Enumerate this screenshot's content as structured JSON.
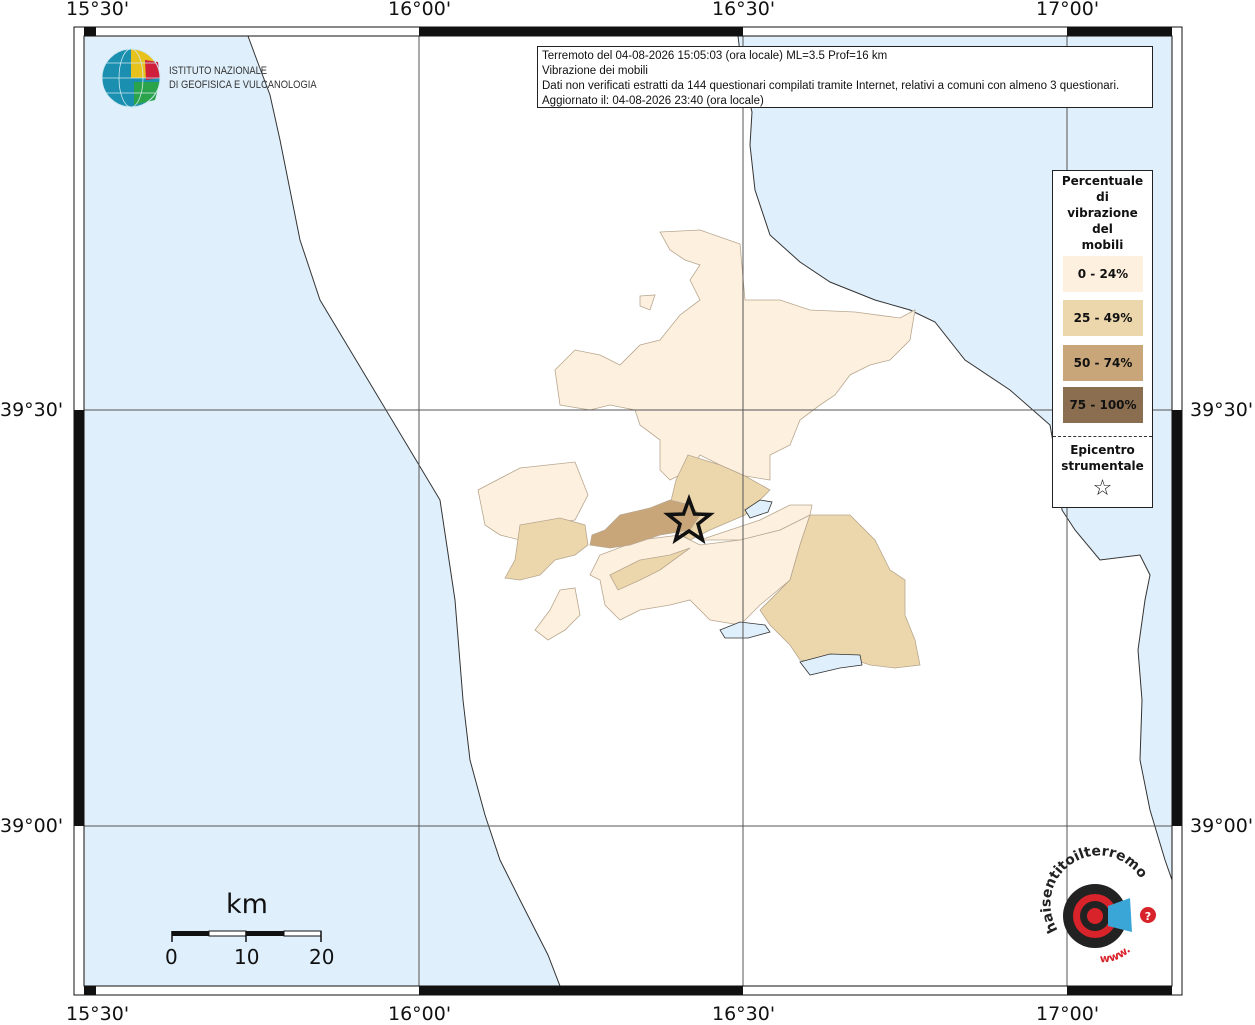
{
  "info": {
    "line1": "Terremoto del 04-08-2026 15:05:03 (ora locale) ML=3.5 Prof=16 km",
    "line2": "Vibrazione dei mobili",
    "line3": "Dati non verificati estratti da 144 questionari compilati tramite Internet, relativi a comuni con almeno 3 questionari.",
    "line4": "Aggiornato il: 04-08-2026 23:40 (ora locale)"
  },
  "frame": {
    "top_labels": [
      "15°30'",
      "16°00'",
      "16°30'",
      "17°00'"
    ],
    "bottom_labels": [
      "15°30'",
      "16°00'",
      "16°30'",
      "17°00'"
    ],
    "left_labels": [
      "39°30'",
      "39°00'"
    ],
    "right_labels": [
      "39°30'",
      "39°00'"
    ]
  },
  "logo": {
    "line1": "ISTITUTO NAZIONALE",
    "line2": "DI GEOFISICA E VULCANOLOGIA"
  },
  "legend": {
    "title_lines": [
      "Percentuale",
      "di",
      "vibrazione",
      "del",
      "mobili"
    ],
    "classes": [
      {
        "label": "0 - 24%",
        "color": "#fdf0de"
      },
      {
        "label": "25 - 49%",
        "color": "#ecd7ad"
      },
      {
        "label": "50 - 74%",
        "color": "#c9a67a"
      },
      {
        "label": "75 - 100%",
        "color": "#8b6e50"
      }
    ],
    "epicenter_lines": [
      "Epicentro",
      "strumentale"
    ],
    "epicenter_symbol": "☆"
  },
  "scale": {
    "title": "km",
    "ticks": [
      "0",
      "10",
      "20"
    ]
  },
  "watermark": {
    "text": "haisentitoilterremoto.it",
    "prefix": "www."
  },
  "colors": {
    "sea": "#dff0fc",
    "land": "#ffffff",
    "coast": "#333333"
  }
}
